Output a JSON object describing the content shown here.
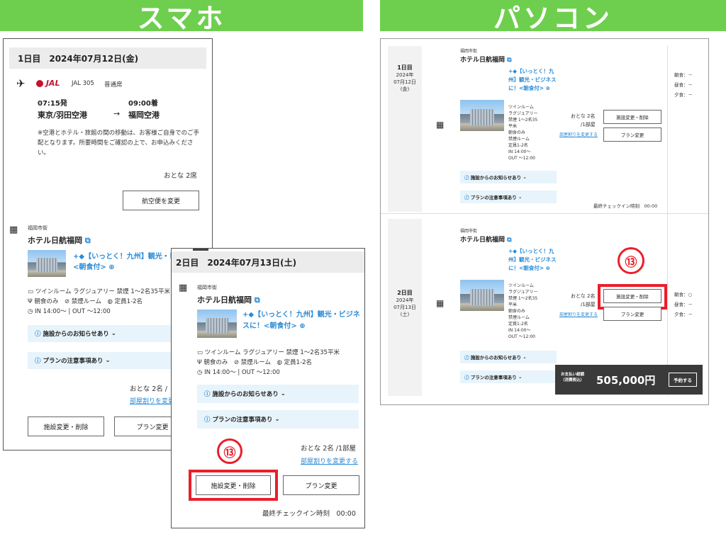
{
  "banners": {
    "smartphone": "スマホ",
    "pc": "パソコン"
  },
  "callout_number": "⑬",
  "sp_day1": {
    "header": "1日目　2024年07月12日(金)",
    "flight": {
      "airline_logo": "JAL",
      "flight": "JAL 305",
      "seat_class": "普通席",
      "dep_time": "07:15発",
      "arr_time": "09:00着",
      "dep_airport": "東京/羽田空港",
      "arrow": "→",
      "arr_airport": "福岡空港",
      "note": "※空港とホテル・旅館の間の移動は、お客様ご自身でのご手配となります。所要時間をご確認の上で、お申込みください。",
      "passengers": "おとな 2席",
      "change_button": "航空便を変更"
    },
    "hotel": {
      "area": "福岡市街",
      "name": "ホテル日航福岡",
      "plan": "+◆【いっとく！九州】観光・ビジネスに！<朝食付> ⊕",
      "room": "ツインルーム ラグジュアリー 禁煙 1～2名35平米",
      "meal": "朝食のみ",
      "smoking": "禁煙ルーム",
      "capacity": "定員1-2名",
      "checkin": "IN 14:00～ | OUT ～12:00"
    },
    "notice1": "施設からのお知らせあり",
    "notice2": "プランの注意事項あり",
    "guests": "おとな 2名 /",
    "change_rooms": "部屋割りを変更",
    "btn_facility": "施設変更・削除",
    "btn_plan": "プラン変更"
  },
  "sp_day2": {
    "header": "2日目　2024年07月13日(土)",
    "hotel": {
      "area": "福岡市街",
      "name": "ホテル日航福岡",
      "plan": "+◆【いっとく！九州】観光・ビジネスに！<朝食付> ⊕",
      "room": "ツインルーム ラグジュアリー 禁煙 1～2名35平米",
      "meal": "朝食のみ",
      "smoking": "禁煙ルーム",
      "capacity": "定員1-2名",
      "checkin": "IN 14:00～ | OUT ～12:00"
    },
    "notice1": "施設からのお知らせあり",
    "notice2": "プランの注意事項あり",
    "guests": "おとな 2名 /1部屋",
    "change_rooms": "部屋割りを変更する",
    "btn_facility": "施設変更・削除",
    "btn_plan": "プラン変更",
    "last_checkin": "最終チェックイン時刻　00:00"
  },
  "pc": {
    "day1": {
      "label": "1日目",
      "year": "2024年",
      "date": "07月12日",
      "dow": "(金)",
      "area": "福岡市街",
      "name": "ホテル日航福岡",
      "plan": "+◆【いっとく！九州】観光・ビジネスに！<朝食付> ⊕",
      "room_lines": [
        "ツインルーム",
        "ラグジュアリー",
        "禁煙 1～2名35",
        "平米"
      ],
      "meal": "朝食のみ",
      "smoking": "禁煙ルーム",
      "capacity": "定員1-2名",
      "checkin": [
        "IN 14:00～",
        "OUT ～12:00"
      ],
      "guests": "おとな 2名",
      "rooms": "/1部屋",
      "change_rooms": "部屋割りを変更する",
      "btn_facility": "施設変更・削除",
      "btn_plan": "プラン変更",
      "meals": [
        "朝食：－",
        "昼食：－",
        "夕食：－"
      ],
      "notice1": "施設からのお知らせあり",
      "notice2": "プランの注意事項あり",
      "last_checkin": "最終チェックイン時刻　00:00"
    },
    "day2": {
      "label": "2日目",
      "year": "2024年",
      "date": "07月13日",
      "dow": "(土)",
      "area": "福岡市街",
      "name": "ホテル日航福岡",
      "plan": "+◆【いっとく！九州】観光・ビジネスに！<朝食付> ⊕",
      "room_lines": [
        "ツインルーム",
        "ラグジュアリー",
        "禁煙 1～2名35",
        "平米"
      ],
      "meal": "朝食のみ",
      "smoking": "禁煙ルーム",
      "capacity": "定員1-2名",
      "checkin": [
        "IN 14:00～",
        "OUT ～12:00"
      ],
      "guests": "おとな 2名",
      "rooms": "/1部屋",
      "change_rooms": "部屋割りを変更する",
      "btn_facility": "施設変更・削除",
      "btn_plan": "プラン変更",
      "meals": [
        "朝食：○",
        "昼食：－",
        "夕食：－"
      ],
      "notice1": "施設からのお知らせあり",
      "notice2": "プランの注意事項あり"
    },
    "payment": {
      "label": "お支払い総額",
      "tax": "（消費税込）",
      "amount": "505,000円",
      "reserve": "予約する"
    }
  },
  "colors": {
    "banner": "#6ecf4e",
    "highlight": "#ea1f2a",
    "link": "#2a8bd6",
    "info_bg": "#e8f4fb",
    "pay_bar": "#3a3a3a"
  }
}
